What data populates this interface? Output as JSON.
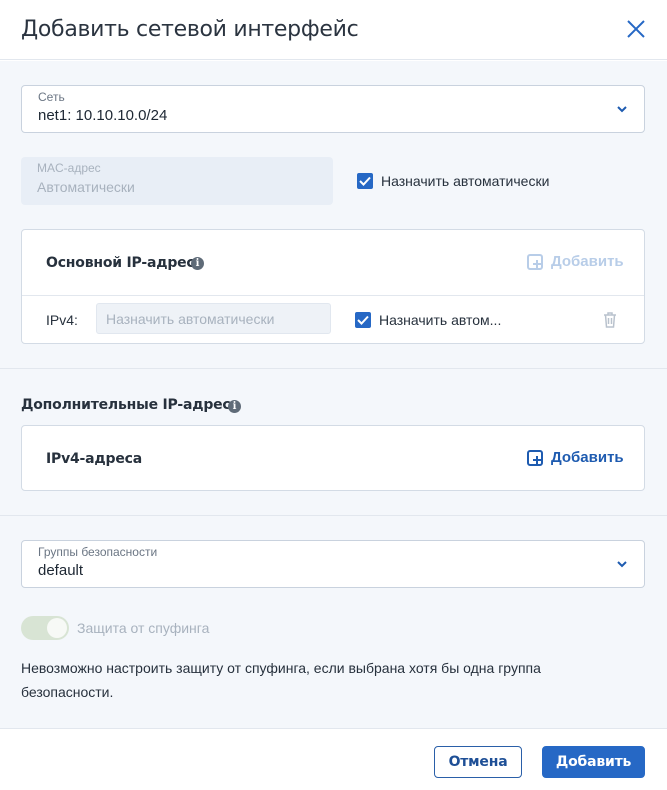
{
  "dialog": {
    "title": "Добавить сетевой интерфейс"
  },
  "network": {
    "label": "Сеть",
    "value": "net1: 10.10.10.0/24"
  },
  "mac": {
    "label": "MAC-адрес",
    "value": "Автоматически",
    "auto_checked": true,
    "auto_label": "Назначить автоматически"
  },
  "primary_ip": {
    "heading": "Основной IP-адрес",
    "add_label": "Добавить",
    "ipv4_label": "IPv4:",
    "ipv4_placeholder": "Назначить автоматически",
    "auto_checked": true,
    "auto_label": "Назначить автом..."
  },
  "additional_ip": {
    "heading": "Дополнительные IP-адреса",
    "card_heading": "IPv4-адреса",
    "add_label": "Добавить"
  },
  "security_groups": {
    "label": "Группы безопасности",
    "value": "default"
  },
  "spoofing": {
    "label": "Защита от спуфинга",
    "enabled": true,
    "note": "Невозможно настроить защиту от спуфинга, если выбрана хотя бы одна группа безопасности."
  },
  "footer": {
    "cancel_label": "Отмена",
    "add_label": "Добавить"
  },
  "colors": {
    "primary": "#2668c5",
    "disabled_accent": "#b8cde8",
    "background": "#f4f7fb"
  },
  "icons": {
    "close": "close-icon",
    "chevron": "chevron-down-icon",
    "info": "info-icon",
    "plus": "plus-square-icon",
    "trash": "trash-icon",
    "check": "check-icon"
  }
}
